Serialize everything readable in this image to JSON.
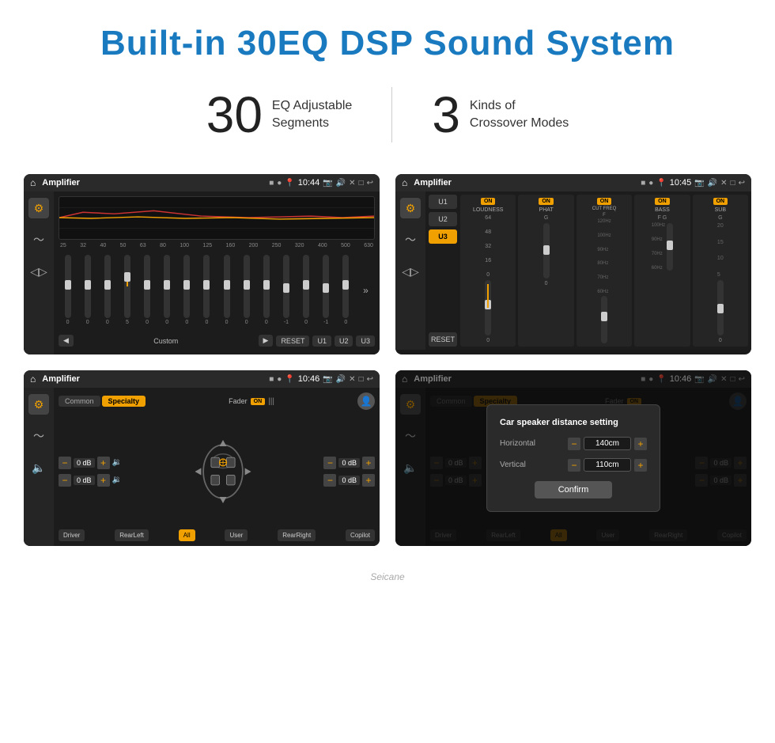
{
  "header": {
    "title": "Built-in 30EQ DSP Sound System",
    "title_color": "#1a7abf"
  },
  "stats": [
    {
      "number": "30",
      "desc_line1": "EQ Adjustable",
      "desc_line2": "Segments"
    },
    {
      "number": "3",
      "desc_line1": "Kinds of",
      "desc_line2": "Crossover Modes"
    }
  ],
  "screens": [
    {
      "id": "screen-1",
      "status_bar": {
        "title": "Amplifier",
        "time": "10:44",
        "icons": [
          "▶",
          "📷",
          "🔊",
          "✕",
          "□",
          "↩"
        ]
      },
      "type": "eq",
      "eq_freqs": [
        "25",
        "32",
        "40",
        "50",
        "63",
        "80",
        "100",
        "125",
        "160",
        "200",
        "250",
        "320",
        "400",
        "500",
        "630"
      ],
      "eq_values": [
        0,
        0,
        0,
        5,
        0,
        0,
        0,
        0,
        0,
        0,
        0,
        -1,
        0,
        -1,
        0
      ],
      "preset_buttons": [
        "Custom",
        "RESET",
        "U1",
        "U2",
        "U3"
      ]
    },
    {
      "id": "screen-2",
      "status_bar": {
        "title": "Amplifier",
        "time": "10:45",
        "icons": [
          "📷",
          "🔊",
          "✕",
          "□",
          "↩"
        ]
      },
      "type": "crossover",
      "channels": [
        "U1",
        "U2",
        "U3"
      ],
      "active_channel": "U3",
      "processors": [
        {
          "name": "LOUDNESS",
          "on": true
        },
        {
          "name": "PHAT",
          "on": true
        },
        {
          "name": "CUT FREQ",
          "on": true
        },
        {
          "name": "BASS",
          "on": true
        },
        {
          "name": "SUB",
          "on": true
        }
      ]
    },
    {
      "id": "screen-3",
      "status_bar": {
        "title": "Amplifier",
        "time": "10:46",
        "icons": [
          "📷",
          "🔊",
          "✕",
          "□",
          "↩"
        ]
      },
      "type": "fader",
      "tabs": [
        "Common",
        "Specialty"
      ],
      "active_tab": "Specialty",
      "fader_label": "Fader",
      "fader_on": true,
      "channels": {
        "fl": "0 dB",
        "fr": "0 dB",
        "rl": "0 dB",
        "rr": "0 dB"
      },
      "position_buttons": [
        "Driver",
        "RearLeft",
        "All",
        "User",
        "RearRight",
        "Copilot"
      ]
    },
    {
      "id": "screen-4",
      "status_bar": {
        "title": "Amplifier",
        "time": "10:46",
        "icons": [
          "📷",
          "🔊",
          "✕",
          "□",
          "↩"
        ]
      },
      "type": "fader_dialog",
      "tabs": [
        "Common",
        "Specialty"
      ],
      "active_tab": "Specialty",
      "dialog": {
        "title": "Car speaker distance setting",
        "horizontal_label": "Horizontal",
        "horizontal_value": "140cm",
        "vertical_label": "Vertical",
        "vertical_value": "110cm",
        "confirm_label": "Confirm"
      },
      "position_buttons": [
        "Driver",
        "RearLeft",
        "All",
        "User",
        "RearRight",
        "Copilot"
      ]
    }
  ],
  "watermark": "Seicane"
}
